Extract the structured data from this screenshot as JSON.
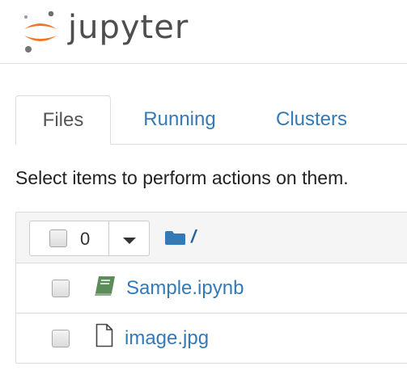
{
  "header": {
    "logo_text": "jupyter",
    "logo_icon": "jupyter-logo-icon"
  },
  "tabs": [
    {
      "label": "Files",
      "active": true
    },
    {
      "label": "Running",
      "active": false
    },
    {
      "label": "Clusters",
      "active": false
    }
  ],
  "instructions": "Select items to perform actions on them.",
  "toolbar": {
    "selected_count": "0",
    "breadcrumb_icon": "folder-icon",
    "breadcrumb_path": "/"
  },
  "files": [
    {
      "name": "Sample.ipynb",
      "icon": "notebook-icon"
    },
    {
      "name": "image.jpg",
      "icon": "file-icon"
    }
  ],
  "colors": {
    "link": "#337ab7",
    "jupyter_orange": "#f37626",
    "notebook_green": "#5b8c5a"
  }
}
